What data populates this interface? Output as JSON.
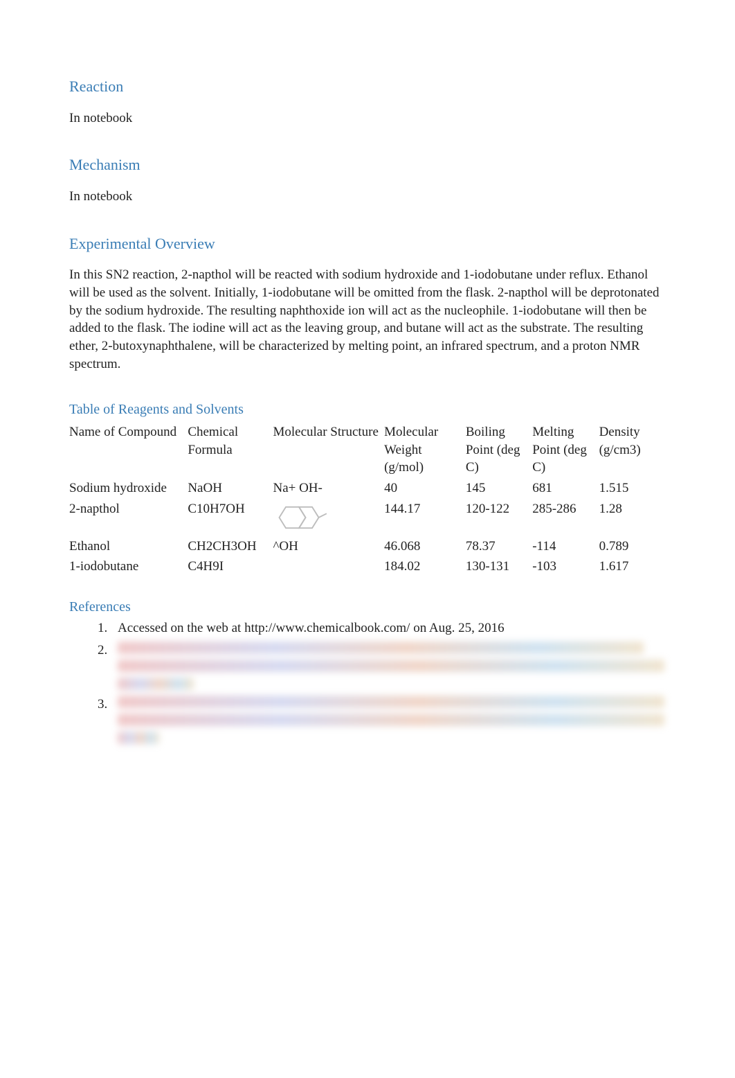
{
  "sections": {
    "reaction": {
      "heading": "Reaction",
      "body": "In notebook"
    },
    "mechanism": {
      "heading": "Mechanism",
      "body": "In notebook"
    },
    "overview": {
      "heading": "Experimental Overview",
      "body": "In this SN2 reaction, 2-napthol will be reacted with sodium hydroxide and 1-iodobutane under reflux. Ethanol will be used as the solvent. Initially, 1-iodobutane will be omitted from the flask. 2-napthol will be deprotonated by the sodium hydroxide. The resulting  naphthoxide ion  will act as the nucleophile. 1-iodobutane will then be added to the flask. The iodine will act as the leaving group, and butane will act as the substrate. The resulting ether, 2-butoxynaphthalene, will be characterized by melting point, an infrared spectrum, and a proton NMR spectrum."
    },
    "table": {
      "heading": "Table of Reagents and Solvents",
      "headers": {
        "name": "Name of Compound",
        "formula": "Chemical Formula",
        "structure": "Molecular Structure",
        "mw": "Molecular Weight (g/mol)",
        "bp": "Boiling Point (deg C)",
        "mp": "Melting Point (deg C)",
        "density": "Density (g/cm3)"
      },
      "rows": [
        {
          "name": "Sodium hydroxide",
          "formula": "NaOH",
          "structure": "Na+ OH-",
          "mw": "40",
          "bp": "145",
          "mp": "681",
          "density": "1.515"
        },
        {
          "name": "2-napthol",
          "formula": "C10H7OH",
          "structure": "",
          "mw": "144.17",
          "bp": "120-122",
          "mp": "285-286",
          "density": "1.28"
        },
        {
          "name": "Ethanol",
          "formula": "CH2CH3OH",
          "structure": "^OH",
          "mw": "46.068",
          "bp": "78.37",
          "mp": "-114",
          "density": "0.789"
        },
        {
          "name": "1-iodobutane",
          "formula": "C4H9I",
          "structure": "",
          "mw": "184.02",
          "bp": "130-131",
          "mp": "-103",
          "density": "1.617"
        }
      ]
    },
    "references": {
      "heading": "References",
      "items": {
        "r1": "Accessed on the web at http://www.chemicalbook.com/ on Aug. 25, 2016"
      }
    }
  }
}
